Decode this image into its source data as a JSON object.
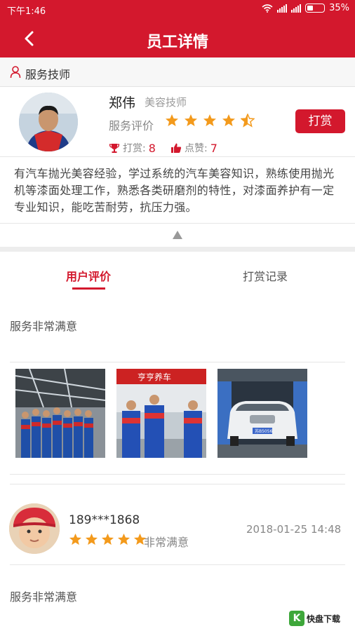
{
  "status_bar": {
    "time": "下午1:46",
    "battery": "35%",
    "battery_level": 0.35
  },
  "nav": {
    "title": "员工详情"
  },
  "role_section": {
    "label": "服务技师"
  },
  "employee": {
    "name": "郑伟",
    "role": "美容技师",
    "rating_label": "服务评价",
    "rating": 4.5,
    "reward_label": "打赏:",
    "reward_count": "8",
    "like_label": "点赞:",
    "like_count": "7",
    "reward_button": "打赏",
    "bio": "有汽车抛光美容经验，学过系统的汽车美容知识，熟练使用抛光机等漆面处理工作，熟悉各类研磨剂的特性，对漆面养护有一定专业知识，能吃苦耐劳，抗压力强。"
  },
  "tabs": [
    {
      "label": "用户评价",
      "active": true
    },
    {
      "label": "打赏记录",
      "active": false
    }
  ],
  "reviews": [
    {
      "text": "服务非常满意"
    },
    {
      "text": "服务非常满意"
    }
  ],
  "photo_overlays": {
    "shop_sign": "亨亨养车",
    "plate": "苏B5056"
  },
  "reviewer": {
    "name": "189***1868",
    "stars": 5,
    "level": "非常满意",
    "date": "2018-01-25 14:48"
  },
  "watermark": {
    "text": "快盘下载"
  },
  "colors": {
    "brand": "#d3182d",
    "star": "#f39a1c"
  },
  "icons": [
    "back-arrow-icon",
    "person-icon",
    "trophy-icon",
    "thumbs-up-icon",
    "star-icon",
    "collapse-triangle-icon",
    "wifi-icon",
    "signal-icon",
    "battery-icon"
  ]
}
